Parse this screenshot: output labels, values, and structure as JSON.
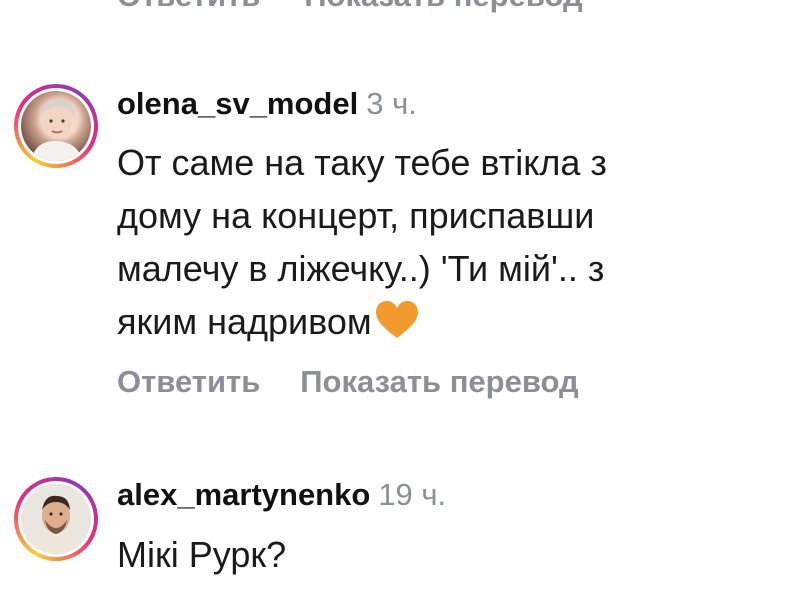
{
  "top_actions": {
    "reply_label": "Ответить",
    "translate_label": "Показать перевод"
  },
  "comments": [
    {
      "username": "olena_sv_model",
      "time": "3 ч.",
      "lines": [
        "От саме на таку тебе втікла з",
        "дому на концерт, приспавши",
        "малечу в ліжечку..) 'Ти мій'.. з",
        "яким надривом"
      ],
      "emoji": "orange-heart",
      "reply_label": "Ответить",
      "translate_label": "Показать перевод"
    },
    {
      "username": "alex_martynenko",
      "time": "19 ч.",
      "lines": [
        "Мікі Рурк?"
      ]
    }
  ],
  "colors": {
    "muted": "#8a8f99",
    "heart": "#f39a2e"
  }
}
